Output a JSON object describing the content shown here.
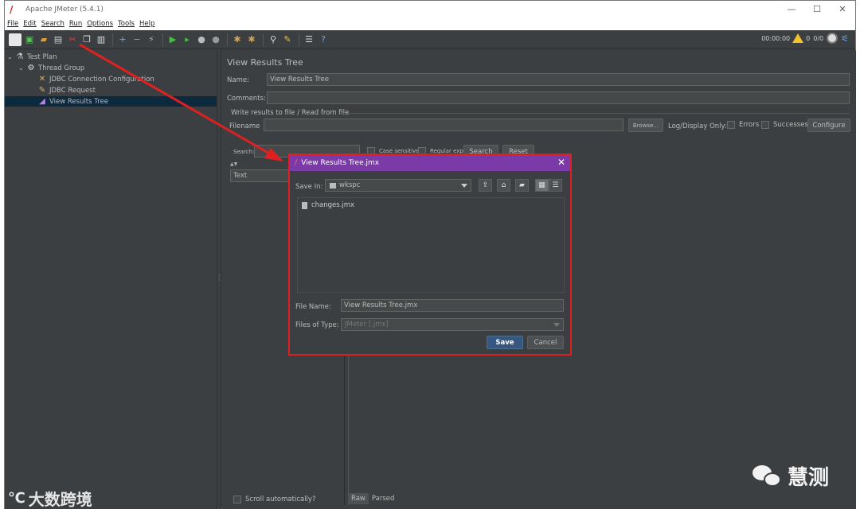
{
  "window": {
    "title": "Apache JMeter (5.4.1)",
    "controls": {
      "minimize": "—",
      "maximize": "☐",
      "close": "✕"
    }
  },
  "menu": [
    "File",
    "Edit",
    "Search",
    "Run",
    "Options",
    "Tools",
    "Help"
  ],
  "status": {
    "timer": "00:00:00",
    "warnings": "0",
    "threads": "0/0"
  },
  "tree": {
    "items": [
      {
        "label": "Test Plan",
        "icon": "flask-icon"
      },
      {
        "label": "Thread Group",
        "icon": "gear-icon"
      },
      {
        "label": "JDBC Connection Configuration",
        "icon": "wrench-icon"
      },
      {
        "label": "JDBC Request",
        "icon": "pen-icon"
      },
      {
        "label": "View Results Tree",
        "icon": "chart-icon",
        "selected": true
      }
    ]
  },
  "panel": {
    "heading": "View Results Tree",
    "name_label": "Name:",
    "name_value": "View Results Tree",
    "comments_label": "Comments:",
    "group_title": "Write results to file / Read from file",
    "filename_label": "Filename",
    "browse": "Browse...",
    "log_display": "Log/Display Only:",
    "errors": "Errors",
    "successes": "Successes",
    "configure": "Configure",
    "search_label": "Search:",
    "case_sensitive": "Case sensitive",
    "regular_exp": "Regular exp.",
    "search_btn": "Search",
    "reset_btn": "Reset",
    "renderer": "Text",
    "scroll_auto": "Scroll automatically?",
    "tabs": [
      "Raw",
      "Parsed"
    ]
  },
  "dialog": {
    "title": "View Results Tree.jmx",
    "save_in_label": "Save In:",
    "save_in_value": "wkspc",
    "files": [
      "changes.jmx"
    ],
    "file_name_label": "File Name:",
    "file_name_value": "View Results Tree.jmx",
    "files_of_type_label": "Files of Type:",
    "files_of_type_value": "JMeter [.jmx]",
    "save": "Save",
    "cancel": "Cancel"
  },
  "watermarks": {
    "left": "大数跨境",
    "right": "慧测"
  },
  "colors": {
    "accent_red": "#e02020",
    "dialog_title": "#7a3aa8",
    "save_button": "#365880",
    "selection": "#0d293e"
  }
}
